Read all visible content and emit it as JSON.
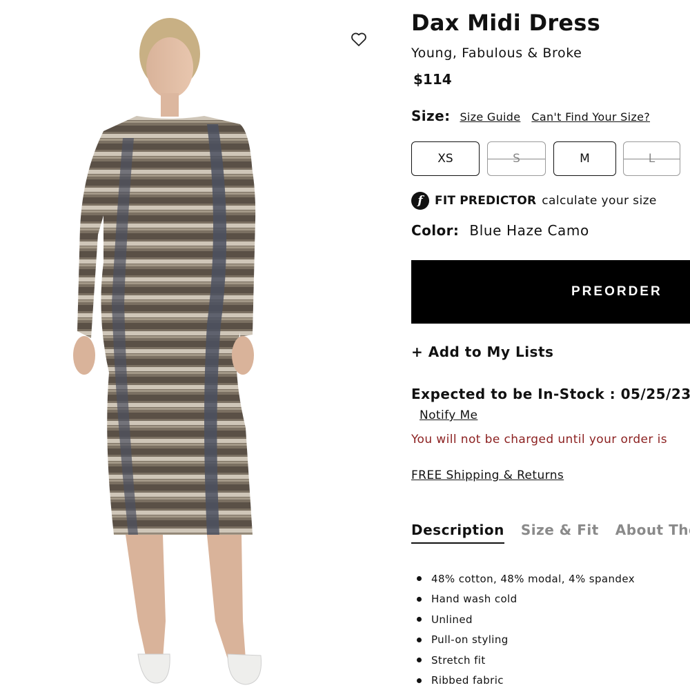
{
  "product": {
    "name": "Dax Midi Dress",
    "brand": "Young, Fabulous & Broke",
    "price": "$114"
  },
  "size": {
    "label": "Size:",
    "guide_link": "Size Guide",
    "cant_find_link": "Can't Find Your Size?",
    "options": [
      {
        "label": "XS",
        "available": true
      },
      {
        "label": "S",
        "available": false
      },
      {
        "label": "M",
        "available": true
      },
      {
        "label": "L",
        "available": false
      }
    ]
  },
  "fit_predictor": {
    "icon_letter": "f",
    "strong": "FIT PREDICTOR",
    "text": "calculate your size"
  },
  "color": {
    "label": "Color:",
    "value": "Blue Haze Camo"
  },
  "actions": {
    "preorder": "PREORDER",
    "add_to_lists": "+ Add to My Lists"
  },
  "availability": {
    "expected": "Expected to be In-Stock : 05/25/23",
    "notify": "Notify Me",
    "charge_note": "You will not be charged until your order is"
  },
  "shipping": "FREE Shipping & Returns",
  "tabs": [
    "Description",
    "Size & Fit",
    "About The"
  ],
  "description": [
    "48% cotton, 48% modal, 4% spandex",
    "Hand wash cold",
    "Unlined",
    "Pull-on styling",
    "Stretch fit",
    "Ribbed fabric"
  ],
  "colors": {
    "accent": "#000000",
    "text": "#111111",
    "warning": "#8b1f1f",
    "muted_tab": "#8a8a8a"
  },
  "icons": {
    "wishlist": "heart-outline-icon",
    "fit": "fit-predictor-icon"
  }
}
